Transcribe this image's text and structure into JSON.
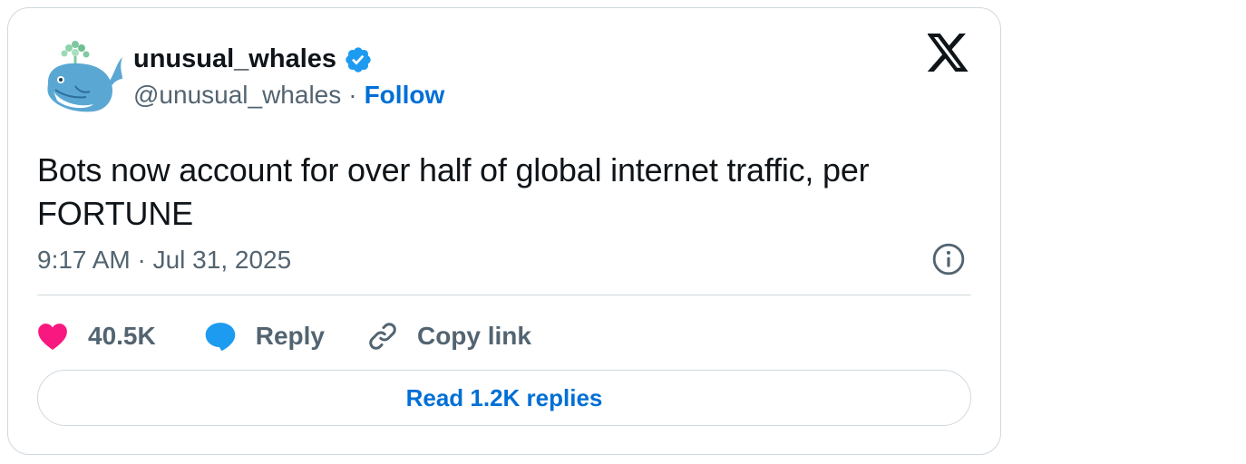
{
  "author": {
    "display_name": "unusual_whales",
    "handle": "@unusual_whales",
    "separator": "·",
    "follow_label": "Follow",
    "verified": true,
    "avatar_icon": "whale-avatar-icon",
    "verified_icon": "verified-badge-icon"
  },
  "platform_logo": "x-logo-icon",
  "tweet": {
    "text": "Bots now account for over half of global internet traffic, per FORTUNE",
    "timestamp": "9:17 AM · Jul 31, 2025"
  },
  "actions": {
    "like_count": "40.5K",
    "reply_label": "Reply",
    "copy_link_label": "Copy link",
    "icons": [
      "heart-icon",
      "reply-bubble-icon",
      "link-icon",
      "info-icon"
    ]
  },
  "read_replies_label": "Read 1.2K replies",
  "colors": {
    "link_blue": "#006fd6",
    "like_pink": "#f91880",
    "reply_blue": "#1d9bf0",
    "verified_blue": "#1d9bf0",
    "secondary_text": "#536471",
    "border": "#cfd9de"
  }
}
